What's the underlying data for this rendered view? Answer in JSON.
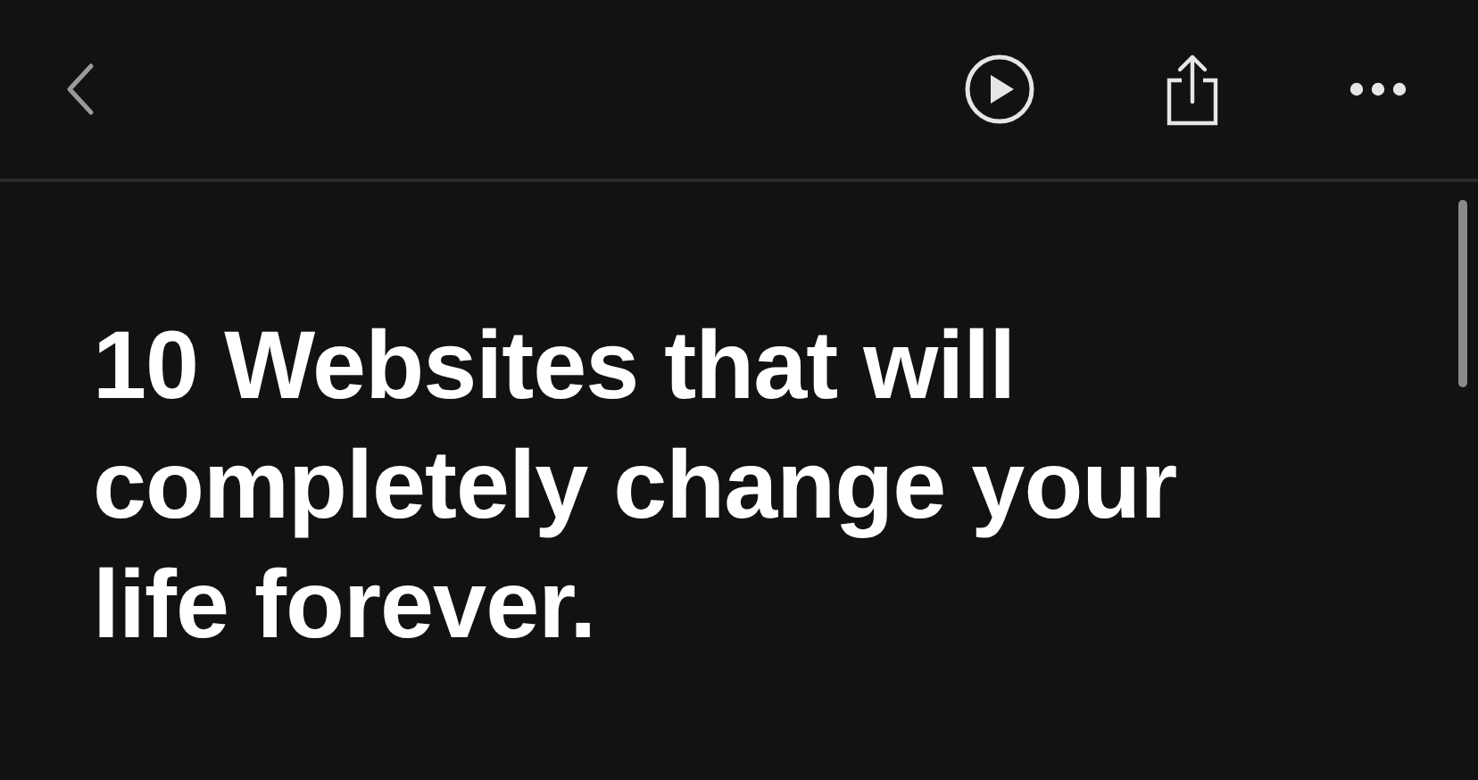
{
  "toolbar": {
    "buttons": [
      {
        "kind": "back"
      },
      {
        "kind": "listen"
      },
      {
        "kind": "share"
      },
      {
        "kind": "more"
      }
    ]
  },
  "article": {
    "title": "10 Websites that will completely change your life forever."
  }
}
